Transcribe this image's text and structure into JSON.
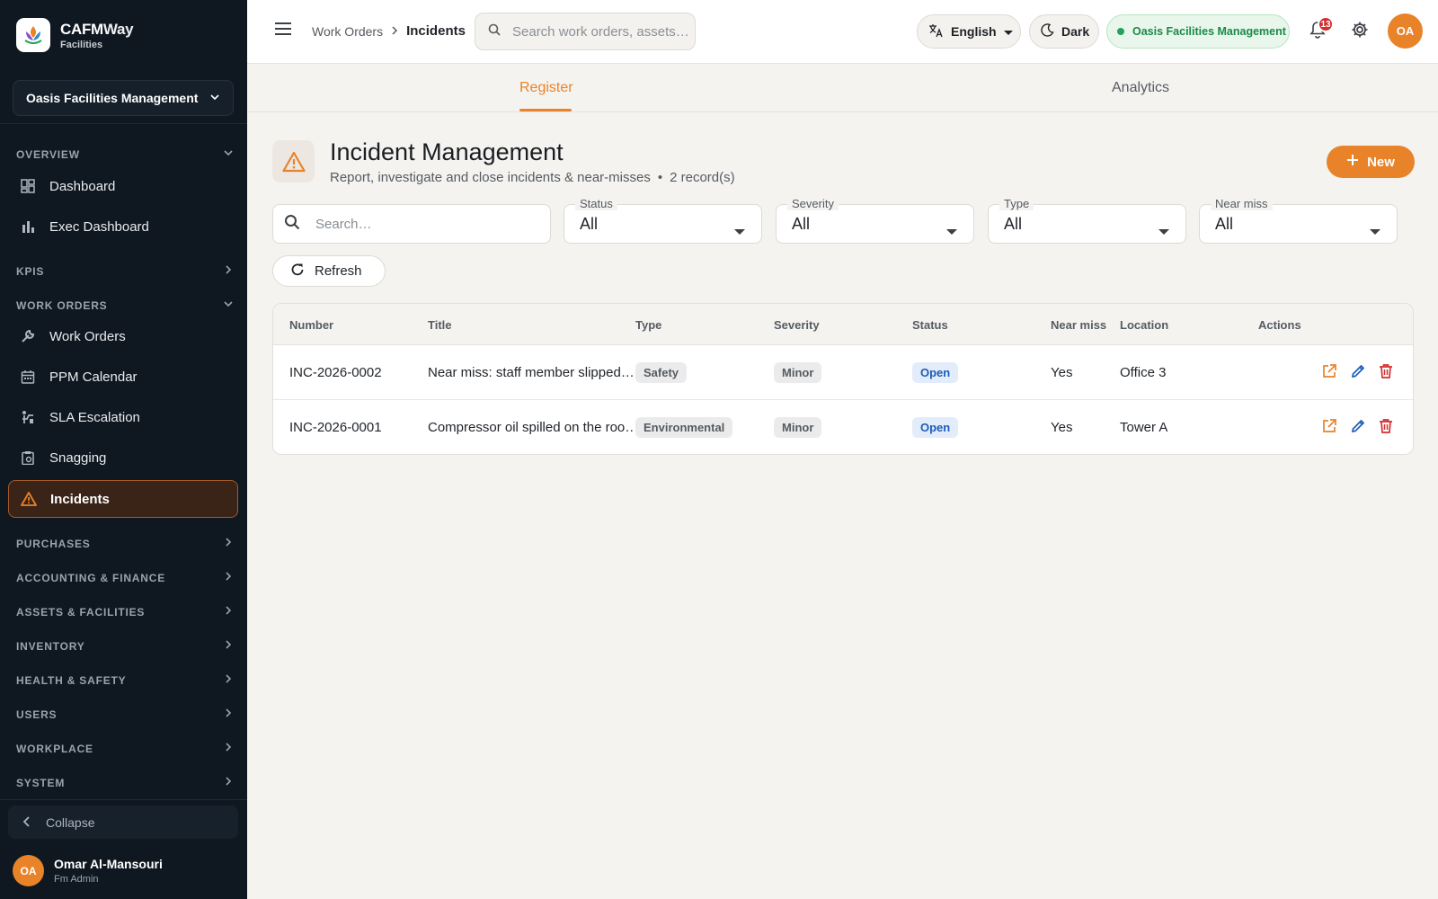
{
  "brand": {
    "name_prefix": "CAFM",
    "name_suffix": "Way",
    "sub": "Facilities"
  },
  "org_selector": {
    "value": "Oasis Facilities Management"
  },
  "sidebar": {
    "sections": [
      {
        "label": "OVERVIEW"
      },
      {
        "label": "KPIS"
      },
      {
        "label": "WORK ORDERS"
      },
      {
        "label": "PURCHASES"
      },
      {
        "label": "ACCOUNTING & FINANCE"
      },
      {
        "label": "ASSETS & FACILITIES"
      },
      {
        "label": "INVENTORY"
      },
      {
        "label": "HEALTH & SAFETY"
      },
      {
        "label": "USERS"
      },
      {
        "label": "WORKPLACE"
      },
      {
        "label": "SYSTEM"
      }
    ],
    "items": [
      {
        "label": "Dashboard",
        "icon": "dashboard-icon"
      },
      {
        "label": "Exec Dashboard",
        "icon": "bar-chart-icon"
      },
      {
        "label": "Work Orders",
        "icon": "wrench-icon"
      },
      {
        "label": "PPM Calendar",
        "icon": "calendar-icon"
      },
      {
        "label": "SLA Escalation",
        "icon": "escalation-icon"
      },
      {
        "label": "Snagging",
        "icon": "clipboard-icon"
      },
      {
        "label": "Incidents",
        "icon": "warning-icon",
        "active": true
      }
    ],
    "collapse_label": "Collapse"
  },
  "user": {
    "initials": "OA",
    "name": "Omar Al-Mansouri",
    "role": "Fm Admin"
  },
  "topbar": {
    "breadcrumb": [
      "Work Orders",
      "Incidents"
    ],
    "search_placeholder": "Search work orders, assets…",
    "language": "English",
    "theme": "Dark",
    "org": "Oasis Facilities Management",
    "notifications": "13",
    "avatar": "OA"
  },
  "tabs": [
    {
      "label": "Register",
      "active": true
    },
    {
      "label": "Analytics"
    }
  ],
  "header": {
    "title": "Incident Management",
    "subtitle": "Report, investigate and close incidents & near-misses",
    "bullet": "•",
    "count": "2 record(s)",
    "new_label": "New"
  },
  "filters": {
    "search_placeholder": "Search…",
    "status": {
      "label": "Status",
      "value": "All"
    },
    "severity": {
      "label": "Severity",
      "value": "All"
    },
    "type": {
      "label": "Type",
      "value": "All"
    },
    "near_miss": {
      "label": "Near miss",
      "value": "All"
    },
    "refresh_label": "Refresh"
  },
  "table": {
    "columns": [
      "Number",
      "Title",
      "Type",
      "Severity",
      "Status",
      "Near miss",
      "Location",
      "Actions"
    ],
    "rows": [
      {
        "number": "INC-2026-0002",
        "title": "Near miss: staff member slipped…",
        "type": "Safety",
        "severity": "Minor",
        "status": "Open",
        "near_miss": "Yes",
        "location": "Office 3"
      },
      {
        "number": "INC-2026-0001",
        "title": "Compressor oil spilled on the roo…",
        "type": "Environmental",
        "severity": "Minor",
        "status": "Open",
        "near_miss": "Yes",
        "location": "Tower A"
      }
    ]
  },
  "colors": {
    "accent": "#e8832a",
    "sidebar_bg": "#0f1720",
    "status_open": "#1c5db8",
    "danger": "#d32f2f",
    "edit": "#1c5db8"
  }
}
